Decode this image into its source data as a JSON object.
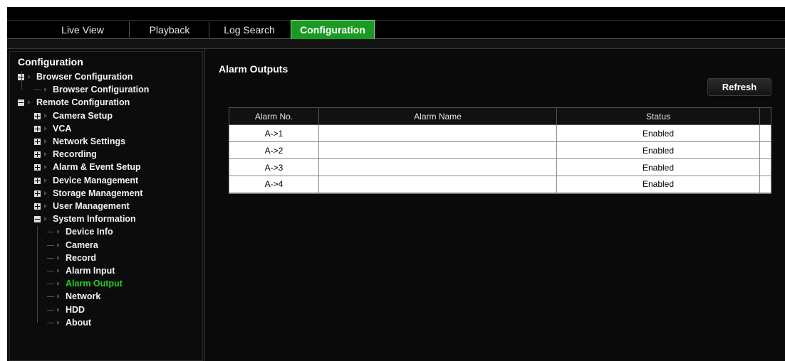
{
  "nav": {
    "tabs": [
      {
        "label": "Live View"
      },
      {
        "label": "Playback"
      },
      {
        "label": "Log Search"
      },
      {
        "label": "Configuration",
        "active": true
      }
    ],
    "active_color": "#1a9a22"
  },
  "sidebar": {
    "title": "Configuration",
    "tree": [
      {
        "label": "Browser Configuration",
        "level": 0,
        "expander": "minus"
      },
      {
        "label": "Browser Configuration",
        "level": 1
      },
      {
        "label": "Remote Configuration",
        "level": 0,
        "expander": "minus"
      },
      {
        "label": "Camera Setup",
        "level": 1,
        "expander": "plus"
      },
      {
        "label": "VCA",
        "level": 1,
        "expander": "plus"
      },
      {
        "label": "Network Settings",
        "level": 1,
        "expander": "plus"
      },
      {
        "label": "Recording",
        "level": 1,
        "expander": "plus"
      },
      {
        "label": "Alarm & Event Setup",
        "level": 1,
        "expander": "plus"
      },
      {
        "label": "Device Management",
        "level": 1,
        "expander": "plus"
      },
      {
        "label": "Storage Management",
        "level": 1,
        "expander": "plus"
      },
      {
        "label": "User Management",
        "level": 1,
        "expander": "plus"
      },
      {
        "label": "System Information",
        "level": 1,
        "expander": "minus"
      },
      {
        "label": "Device Info",
        "level": 2
      },
      {
        "label": "Camera",
        "level": 2
      },
      {
        "label": "Record",
        "level": 2
      },
      {
        "label": "Alarm Input",
        "level": 2
      },
      {
        "label": "Alarm Output",
        "level": 2,
        "selected": true
      },
      {
        "label": "Network",
        "level": 2
      },
      {
        "label": "HDD",
        "level": 2
      },
      {
        "label": "About",
        "level": 2
      }
    ],
    "selected_color": "#1fd11f"
  },
  "content": {
    "title": "Alarm Outputs",
    "refresh_label": "Refresh",
    "table": {
      "headers": [
        "Alarm No.",
        "Alarm Name",
        "Status"
      ],
      "rows": [
        {
          "no": "A->1",
          "name": "",
          "status": "Enabled"
        },
        {
          "no": "A->2",
          "name": "",
          "status": "Enabled"
        },
        {
          "no": "A->3",
          "name": "",
          "status": "Enabled"
        },
        {
          "no": "A->4",
          "name": "",
          "status": "Enabled"
        }
      ]
    }
  }
}
